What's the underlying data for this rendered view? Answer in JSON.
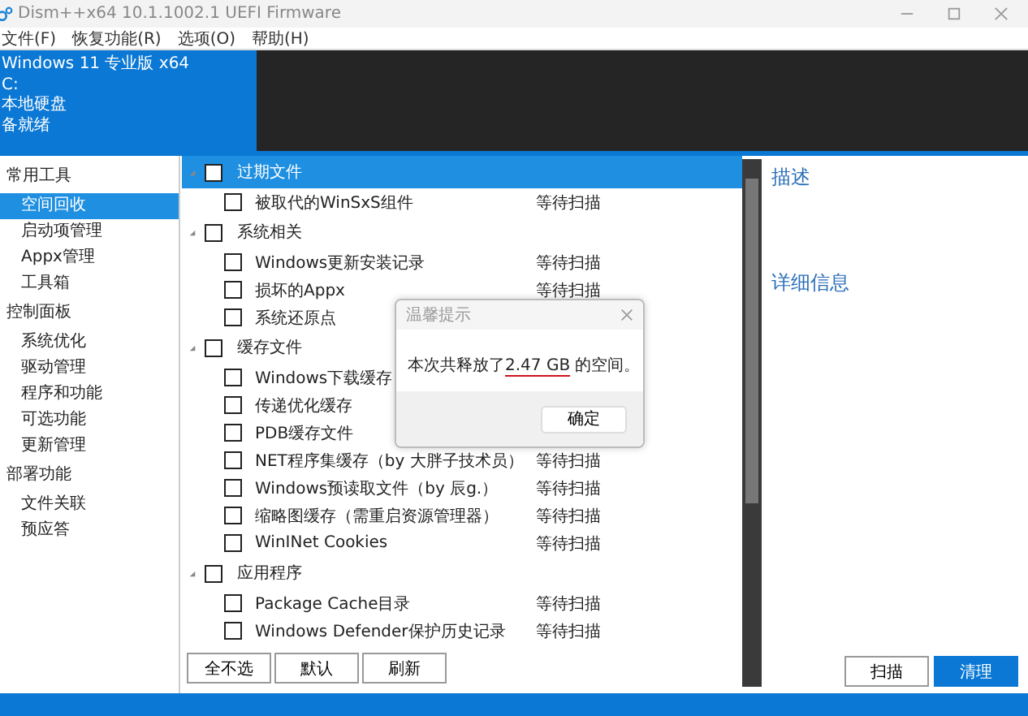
{
  "window": {
    "title": "Dism++x64 10.1.1002.1 UEFI Firmware"
  },
  "menu": [
    "文件(F)",
    "恢复功能(R)",
    "选项(O)",
    "帮助(H)"
  ],
  "system_info": [
    "Windows 11 专业版 x64",
    "C:",
    "本地硬盘",
    "备就绪"
  ],
  "sidebar": [
    {
      "label": "常用工具",
      "children": [
        {
          "label": "空间回收",
          "selected": true
        },
        {
          "label": "启动项管理",
          "selected": false
        },
        {
          "label": "Appx管理",
          "selected": false
        },
        {
          "label": "工具箱",
          "selected": false
        }
      ]
    },
    {
      "label": "控制面板",
      "children": [
        {
          "label": "系统优化",
          "selected": false
        },
        {
          "label": "驱动管理",
          "selected": false
        },
        {
          "label": "程序和功能",
          "selected": false
        },
        {
          "label": "可选功能",
          "selected": false
        },
        {
          "label": "更新管理",
          "selected": false
        }
      ]
    },
    {
      "label": "部署功能",
      "children": [
        {
          "label": "文件关联",
          "selected": false
        },
        {
          "label": "预应答",
          "selected": false
        }
      ]
    }
  ],
  "cleanup_list": [
    {
      "label": "过期文件",
      "selected": true,
      "expanded": true,
      "checked": false,
      "children": [
        {
          "label": "被取代的WinSxS组件",
          "checked": false,
          "status": "等待扫描"
        }
      ]
    },
    {
      "label": "系统相关",
      "selected": false,
      "expanded": true,
      "checked": false,
      "children": [
        {
          "label": "Windows更新安装记录",
          "checked": false,
          "status": "等待扫描"
        },
        {
          "label": "损坏的Appx",
          "checked": false,
          "status": "等待扫描"
        },
        {
          "label": "系统还原点",
          "checked": false
        }
      ]
    },
    {
      "label": "缓存文件",
      "selected": false,
      "expanded": true,
      "checked": false,
      "children": [
        {
          "label": "Windows下载缓存",
          "checked": false
        },
        {
          "label": "传递优化缓存",
          "checked": false
        },
        {
          "label": "PDB缓存文件",
          "checked": false
        },
        {
          "label": "NET程序集缓存（by 大胖子技术员）",
          "checked": false,
          "status": "等待扫描"
        },
        {
          "label": "Windows预读取文件（by 辰g.）",
          "checked": false,
          "status": "等待扫描"
        },
        {
          "label": "缩略图缓存（需重启资源管理器）",
          "checked": false,
          "status": "等待扫描"
        },
        {
          "label": "WinINet Cookies",
          "checked": false,
          "status": "等待扫描"
        }
      ]
    },
    {
      "label": "应用程序",
      "selected": false,
      "expanded": true,
      "checked": false,
      "children": [
        {
          "label": "Package Cache目录",
          "checked": false,
          "status": "等待扫描"
        },
        {
          "label": "Windows Defender保护历史记录",
          "checked": false,
          "status": "等待扫描"
        }
      ]
    }
  ],
  "list_buttons": [
    "全不选",
    "默认",
    "刷新"
  ],
  "details": {
    "description_heading": "描述",
    "details_heading": "详细信息"
  },
  "action_buttons": [
    {
      "label": "扫描",
      "kind": "secondary"
    },
    {
      "label": "清理",
      "kind": "primary"
    }
  ],
  "dialog": {
    "title": "温馨提示",
    "message_before": "本次共释放了",
    "message_highlight": "2.47 GB",
    "message_after": " 的空间。",
    "button": "确定"
  }
}
